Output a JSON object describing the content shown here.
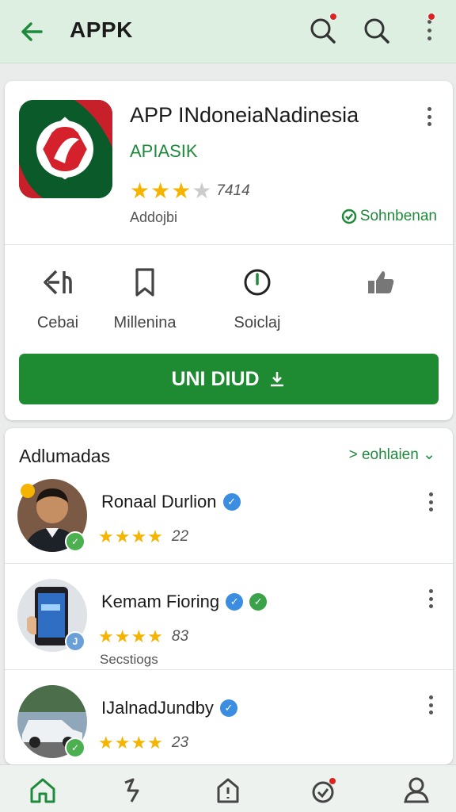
{
  "header": {
    "title": "APPK",
    "icons": [
      "back-arrow-icon",
      "search-alert-icon",
      "search-icon",
      "more-vertical-icon"
    ]
  },
  "app": {
    "name": "APP INdoneiaNadinesia",
    "developer": "APIASIK",
    "rating_stars": "★★★",
    "rating_half": "★",
    "rating_count": "7414",
    "meta": "Addojbi",
    "badge": "Sohnbenan",
    "colors": {
      "accent": "#1e8a31",
      "star": "#f4b400"
    }
  },
  "actions": [
    {
      "label": "Cebai",
      "icon": "share-icon"
    },
    {
      "label": "Millenina",
      "icon": "bookmark-icon"
    },
    {
      "label": "Soiclaj",
      "icon": "compass-icon"
    },
    {
      "label": "",
      "icon": "thumbs-up-icon"
    }
  ],
  "install_button": {
    "label": "UNI DIUD"
  },
  "reviews": {
    "title": "Adlumadas",
    "see_more": "> eohlaien ⌄",
    "items": [
      {
        "name": "Ronaal Durlion",
        "stars": "★★★★",
        "count": "22",
        "sub": ""
      },
      {
        "name": "Kemam Fioring",
        "stars": "★★★★",
        "count": "83",
        "sub": "Secstiogs"
      },
      {
        "name": "IJalnadJundby",
        "stars": "★★★★",
        "count": "23",
        "sub": ""
      }
    ]
  },
  "bottom_nav": [
    "home-icon",
    "lightning-icon",
    "notice-icon",
    "gift-icon",
    "profile-icon"
  ]
}
